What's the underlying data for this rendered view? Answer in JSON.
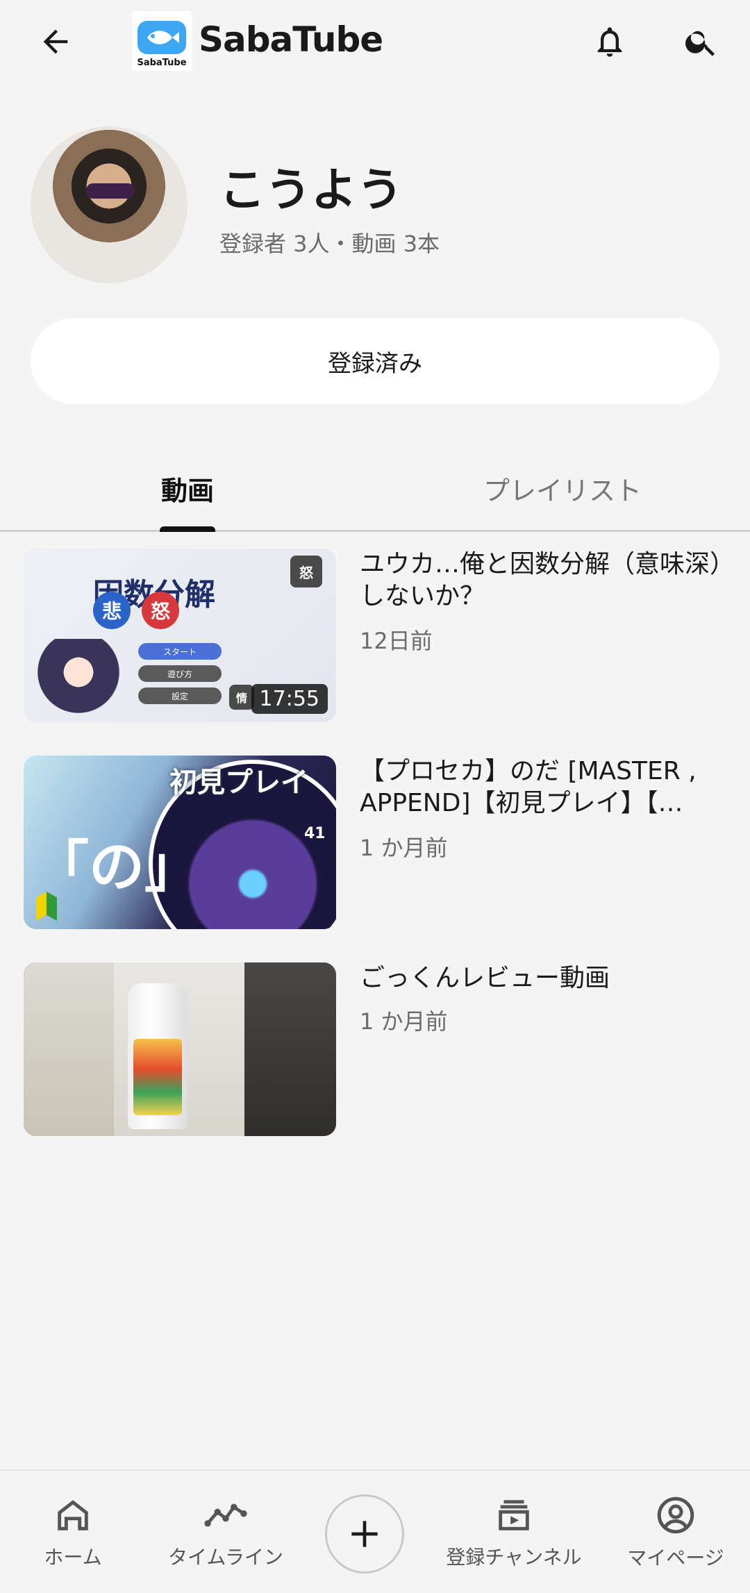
{
  "app": {
    "title": "SabaTube",
    "logo_small_text": "SabaTube"
  },
  "topbar": {
    "back_icon": "arrow-left-icon",
    "notifications_icon": "bell-icon",
    "search_icon": "search-icon"
  },
  "channel": {
    "name": "こうよう",
    "meta": "登録者 3人・動画 3本",
    "subscribe_label": "登録済み"
  },
  "tabs": [
    {
      "label": "動画",
      "active": true
    },
    {
      "label": "プレイリスト",
      "active": false
    }
  ],
  "videos": [
    {
      "title": "ユウカ…俺と因数分解（意味深）しないか？",
      "age": "12日前",
      "duration": "17:55",
      "thumb_text": {
        "title": "因数分解",
        "badge_top": "怒",
        "badge_bottom": "情",
        "circle1": "悲",
        "circle2": "怒",
        "buttons": [
          "スタート",
          "遊び方",
          "設定"
        ]
      }
    },
    {
      "title": "【プロセカ】のだ [MASTER , APPEND]【初見プレイ】【…",
      "age": "1 か月前",
      "thumb_text": {
        "headline": "初見プレイ",
        "big": "「の」",
        "combo": "41"
      }
    },
    {
      "title": "ごっくんレビュー動画",
      "age": "1 か月前"
    }
  ],
  "bottom_nav": {
    "home": {
      "label": "ホーム",
      "icon": "home-icon"
    },
    "timeline": {
      "label": "タイムライン",
      "icon": "timeline-icon"
    },
    "add": {
      "icon": "plus-icon"
    },
    "subscriptions": {
      "label": "登録チャンネル",
      "icon": "subscriptions-icon"
    },
    "mypage": {
      "label": "マイページ",
      "icon": "account-circle-icon"
    }
  },
  "colors": {
    "background": "#f4f4f5",
    "logo_blue": "#3ea6f2",
    "text_primary": "#1a1a1a",
    "text_secondary": "#6b6b6b"
  }
}
